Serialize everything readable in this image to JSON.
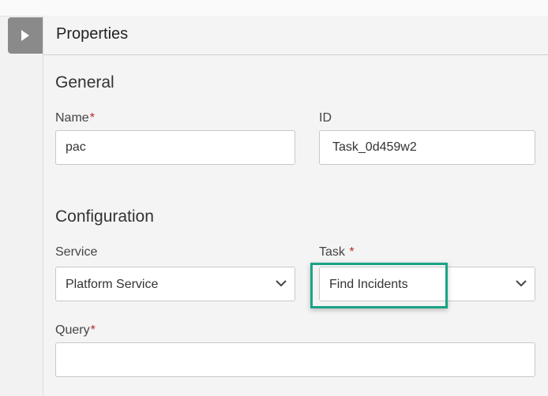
{
  "panel": {
    "title": "Properties"
  },
  "general": {
    "section_title": "General",
    "name": {
      "label": "Name",
      "required_mark": "*",
      "value": "pac"
    },
    "id": {
      "label": "ID",
      "value": "Task_0d459w2"
    }
  },
  "configuration": {
    "section_title": "Configuration",
    "service": {
      "label": "Service",
      "selected": "Platform Service"
    },
    "task": {
      "label": "Task",
      "required_mark": "*",
      "selected": "Find Incidents"
    },
    "query": {
      "label": "Query",
      "required_mark": "*",
      "value": ""
    }
  },
  "icons": {
    "toggle": "triangle-right-icon",
    "dropdown": "chevron-down-icon"
  },
  "colors": {
    "required": "#b52a2a",
    "highlight": "#1aa385",
    "toggle_bg": "#8a8a8a"
  }
}
